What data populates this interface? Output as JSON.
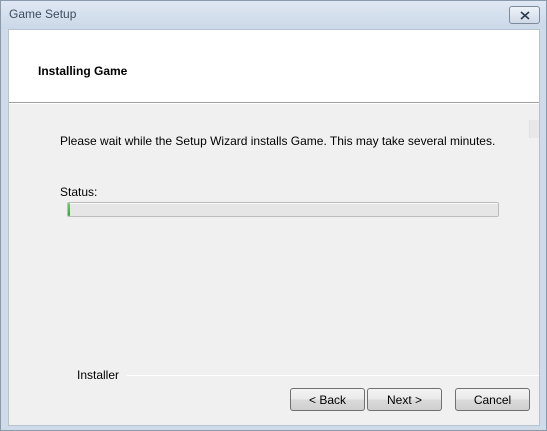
{
  "window": {
    "title": "Game Setup"
  },
  "header": {
    "title": "Installing Game"
  },
  "body": {
    "message": "Please wait while the Setup Wizard installs Game.  This may take several minutes.",
    "status_label": "Status:"
  },
  "progress": {
    "fraction": 0.005,
    "color": "#3cb043"
  },
  "footer": {
    "group_label": "Installer"
  },
  "buttons": {
    "back": "< Back",
    "next": "Next >",
    "cancel": "Cancel"
  },
  "icons": {
    "close": "close-icon"
  }
}
